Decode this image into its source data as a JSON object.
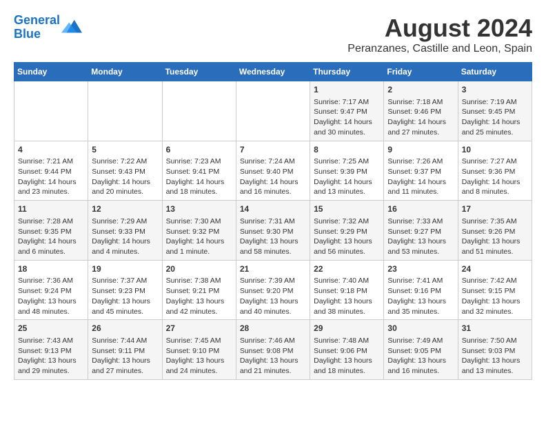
{
  "header": {
    "logo_line1": "General",
    "logo_line2": "Blue",
    "title": "August 2024",
    "subtitle": "Peranzanes, Castille and Leon, Spain"
  },
  "weekdays": [
    "Sunday",
    "Monday",
    "Tuesday",
    "Wednesday",
    "Thursday",
    "Friday",
    "Saturday"
  ],
  "weeks": [
    [
      {
        "num": "",
        "lines": []
      },
      {
        "num": "",
        "lines": []
      },
      {
        "num": "",
        "lines": []
      },
      {
        "num": "",
        "lines": []
      },
      {
        "num": "1",
        "lines": [
          "Sunrise: 7:17 AM",
          "Sunset: 9:47 PM",
          "Daylight: 14 hours",
          "and 30 minutes."
        ]
      },
      {
        "num": "2",
        "lines": [
          "Sunrise: 7:18 AM",
          "Sunset: 9:46 PM",
          "Daylight: 14 hours",
          "and 27 minutes."
        ]
      },
      {
        "num": "3",
        "lines": [
          "Sunrise: 7:19 AM",
          "Sunset: 9:45 PM",
          "Daylight: 14 hours",
          "and 25 minutes."
        ]
      }
    ],
    [
      {
        "num": "4",
        "lines": [
          "Sunrise: 7:21 AM",
          "Sunset: 9:44 PM",
          "Daylight: 14 hours",
          "and 23 minutes."
        ]
      },
      {
        "num": "5",
        "lines": [
          "Sunrise: 7:22 AM",
          "Sunset: 9:43 PM",
          "Daylight: 14 hours",
          "and 20 minutes."
        ]
      },
      {
        "num": "6",
        "lines": [
          "Sunrise: 7:23 AM",
          "Sunset: 9:41 PM",
          "Daylight: 14 hours",
          "and 18 minutes."
        ]
      },
      {
        "num": "7",
        "lines": [
          "Sunrise: 7:24 AM",
          "Sunset: 9:40 PM",
          "Daylight: 14 hours",
          "and 16 minutes."
        ]
      },
      {
        "num": "8",
        "lines": [
          "Sunrise: 7:25 AM",
          "Sunset: 9:39 PM",
          "Daylight: 14 hours",
          "and 13 minutes."
        ]
      },
      {
        "num": "9",
        "lines": [
          "Sunrise: 7:26 AM",
          "Sunset: 9:37 PM",
          "Daylight: 14 hours",
          "and 11 minutes."
        ]
      },
      {
        "num": "10",
        "lines": [
          "Sunrise: 7:27 AM",
          "Sunset: 9:36 PM",
          "Daylight: 14 hours",
          "and 8 minutes."
        ]
      }
    ],
    [
      {
        "num": "11",
        "lines": [
          "Sunrise: 7:28 AM",
          "Sunset: 9:35 PM",
          "Daylight: 14 hours",
          "and 6 minutes."
        ]
      },
      {
        "num": "12",
        "lines": [
          "Sunrise: 7:29 AM",
          "Sunset: 9:33 PM",
          "Daylight: 14 hours",
          "and 4 minutes."
        ]
      },
      {
        "num": "13",
        "lines": [
          "Sunrise: 7:30 AM",
          "Sunset: 9:32 PM",
          "Daylight: 14 hours",
          "and 1 minute."
        ]
      },
      {
        "num": "14",
        "lines": [
          "Sunrise: 7:31 AM",
          "Sunset: 9:30 PM",
          "Daylight: 13 hours",
          "and 58 minutes."
        ]
      },
      {
        "num": "15",
        "lines": [
          "Sunrise: 7:32 AM",
          "Sunset: 9:29 PM",
          "Daylight: 13 hours",
          "and 56 minutes."
        ]
      },
      {
        "num": "16",
        "lines": [
          "Sunrise: 7:33 AM",
          "Sunset: 9:27 PM",
          "Daylight: 13 hours",
          "and 53 minutes."
        ]
      },
      {
        "num": "17",
        "lines": [
          "Sunrise: 7:35 AM",
          "Sunset: 9:26 PM",
          "Daylight: 13 hours",
          "and 51 minutes."
        ]
      }
    ],
    [
      {
        "num": "18",
        "lines": [
          "Sunrise: 7:36 AM",
          "Sunset: 9:24 PM",
          "Daylight: 13 hours",
          "and 48 minutes."
        ]
      },
      {
        "num": "19",
        "lines": [
          "Sunrise: 7:37 AM",
          "Sunset: 9:23 PM",
          "Daylight: 13 hours",
          "and 45 minutes."
        ]
      },
      {
        "num": "20",
        "lines": [
          "Sunrise: 7:38 AM",
          "Sunset: 9:21 PM",
          "Daylight: 13 hours",
          "and 42 minutes."
        ]
      },
      {
        "num": "21",
        "lines": [
          "Sunrise: 7:39 AM",
          "Sunset: 9:20 PM",
          "Daylight: 13 hours",
          "and 40 minutes."
        ]
      },
      {
        "num": "22",
        "lines": [
          "Sunrise: 7:40 AM",
          "Sunset: 9:18 PM",
          "Daylight: 13 hours",
          "and 38 minutes."
        ]
      },
      {
        "num": "23",
        "lines": [
          "Sunrise: 7:41 AM",
          "Sunset: 9:16 PM",
          "Daylight: 13 hours",
          "and 35 minutes."
        ]
      },
      {
        "num": "24",
        "lines": [
          "Sunrise: 7:42 AM",
          "Sunset: 9:15 PM",
          "Daylight: 13 hours",
          "and 32 minutes."
        ]
      }
    ],
    [
      {
        "num": "25",
        "lines": [
          "Sunrise: 7:43 AM",
          "Sunset: 9:13 PM",
          "Daylight: 13 hours",
          "and 29 minutes."
        ]
      },
      {
        "num": "26",
        "lines": [
          "Sunrise: 7:44 AM",
          "Sunset: 9:11 PM",
          "Daylight: 13 hours",
          "and 27 minutes."
        ]
      },
      {
        "num": "27",
        "lines": [
          "Sunrise: 7:45 AM",
          "Sunset: 9:10 PM",
          "Daylight: 13 hours",
          "and 24 minutes."
        ]
      },
      {
        "num": "28",
        "lines": [
          "Sunrise: 7:46 AM",
          "Sunset: 9:08 PM",
          "Daylight: 13 hours",
          "and 21 minutes."
        ]
      },
      {
        "num": "29",
        "lines": [
          "Sunrise: 7:48 AM",
          "Sunset: 9:06 PM",
          "Daylight: 13 hours",
          "and 18 minutes."
        ]
      },
      {
        "num": "30",
        "lines": [
          "Sunrise: 7:49 AM",
          "Sunset: 9:05 PM",
          "Daylight: 13 hours",
          "and 16 minutes."
        ]
      },
      {
        "num": "31",
        "lines": [
          "Sunrise: 7:50 AM",
          "Sunset: 9:03 PM",
          "Daylight: 13 hours",
          "and 13 minutes."
        ]
      }
    ]
  ]
}
